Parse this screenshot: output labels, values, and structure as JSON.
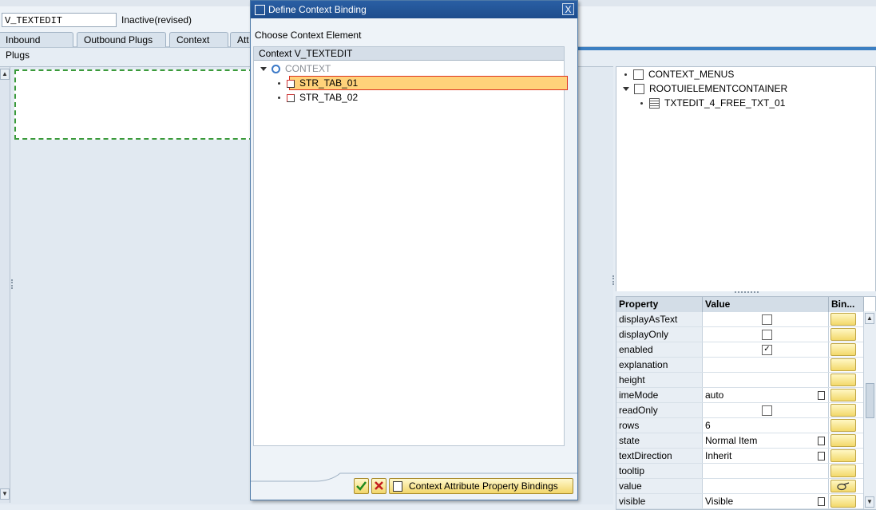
{
  "header": {
    "view_name": "V_TEXTEDIT",
    "status": "Inactive(revised)"
  },
  "tabs": [
    "Inbound Plugs",
    "Outbound Plugs",
    "Context",
    "Att"
  ],
  "ui_tree": {
    "items": [
      {
        "label": "CONTEXT_MENUS"
      },
      {
        "label": "ROOTUIELEMENTCONTAINER"
      },
      {
        "label": "TXTEDIT_4_FREE_TXT_01"
      }
    ]
  },
  "properties": {
    "headers": {
      "property": "Property",
      "value": "Value",
      "binding": "Bin..."
    },
    "rows": [
      {
        "name": "displayAsText",
        "value": "",
        "kind": "checkbox",
        "checked": false
      },
      {
        "name": "displayOnly",
        "value": "",
        "kind": "checkbox",
        "checked": false
      },
      {
        "name": "enabled",
        "value": "",
        "kind": "checkbox",
        "checked": true
      },
      {
        "name": "explanation",
        "value": "",
        "kind": "text"
      },
      {
        "name": "height",
        "value": "",
        "kind": "text"
      },
      {
        "name": "imeMode",
        "value": "auto",
        "kind": "dropdown"
      },
      {
        "name": "readOnly",
        "value": "",
        "kind": "checkbox",
        "checked": false
      },
      {
        "name": "rows",
        "value": "6",
        "kind": "text"
      },
      {
        "name": "state",
        "value": "Normal Item",
        "kind": "dropdown"
      },
      {
        "name": "textDirection",
        "value": "Inherit",
        "kind": "dropdown"
      },
      {
        "name": "tooltip",
        "value": "",
        "kind": "text"
      },
      {
        "name": "value",
        "value": "",
        "kind": "text",
        "bound": true
      },
      {
        "name": "visible",
        "value": "Visible",
        "kind": "dropdown"
      }
    ]
  },
  "dialog": {
    "title": "Define Context Binding",
    "close_label": "X",
    "choose_label": "Choose Context Element",
    "tree_header": "Context V_TEXTEDIT",
    "nodes": [
      {
        "label": "CONTEXT"
      },
      {
        "label": "STR_TAB_01"
      },
      {
        "label": "STR_TAB_02"
      }
    ],
    "buttons": {
      "ok_icon": "checkmark-icon",
      "cancel_icon": "cancel-icon",
      "context_attr_label": "Context Attribute Property Bindings"
    }
  },
  "colors": {
    "selection": "#ffd27a",
    "title_bar": "#1d4c8c",
    "bind_button": "#f3d96b"
  }
}
